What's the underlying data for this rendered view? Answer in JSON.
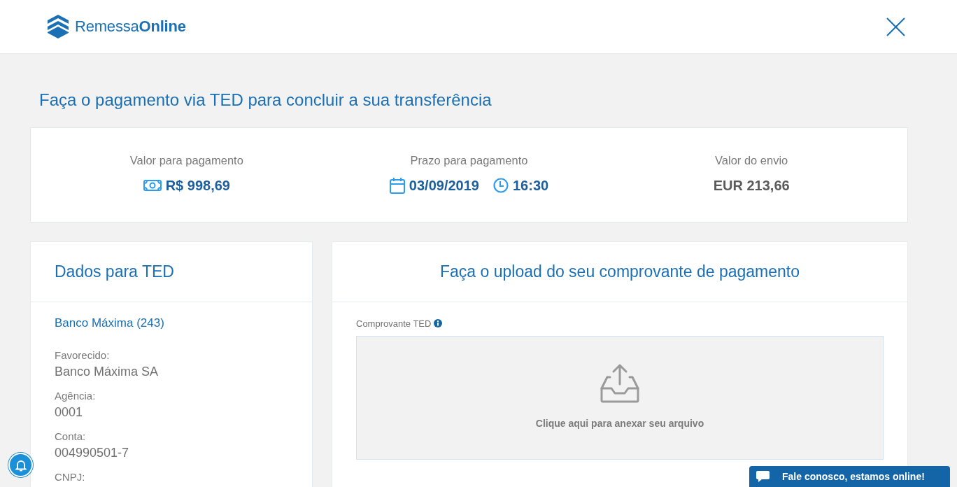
{
  "header": {
    "logo": "Remessa**Online**"
  },
  "page_title": "Faça o pagamento via TED para concluir a sua transferência",
  "summary": [
    {
      "label": "Valor para pagamento",
      "values": [
        {
          "kind": "money",
          "text": "R$ 998,69"
        }
      ]
    },
    {
      "label": "Prazo para pagamento",
      "values": [
        {
          "kind": "date",
          "text": "03/09/2019"
        },
        {
          "kind": "time",
          "text": "16:30"
        }
      ]
    },
    {
      "label": "Valor do envio",
      "values": [
        {
          "kind": "plain",
          "text": "EUR 213,66"
        }
      ]
    }
  ],
  "bank_details": {
    "title": "Dados para TED",
    "bank": "Banco Máxima (243)",
    "fields": [
      {
        "label": "Favorecido:",
        "value": "Banco Máxima SA"
      },
      {
        "label": "Agência:",
        "value": "0001"
      },
      {
        "label": "Conta:",
        "value": "004990501-7"
      },
      {
        "label": "CNPJ:"
      }
    ]
  },
  "upload": {
    "title": "Faça o upload do seu comprovante de pagamento",
    "field_label": "Comprovante TED",
    "dropzone_text": "Clique aqui para anexar seu arquivo"
  },
  "chat_button": {
    "label": "Fale conosco, estamos online!"
  }
}
